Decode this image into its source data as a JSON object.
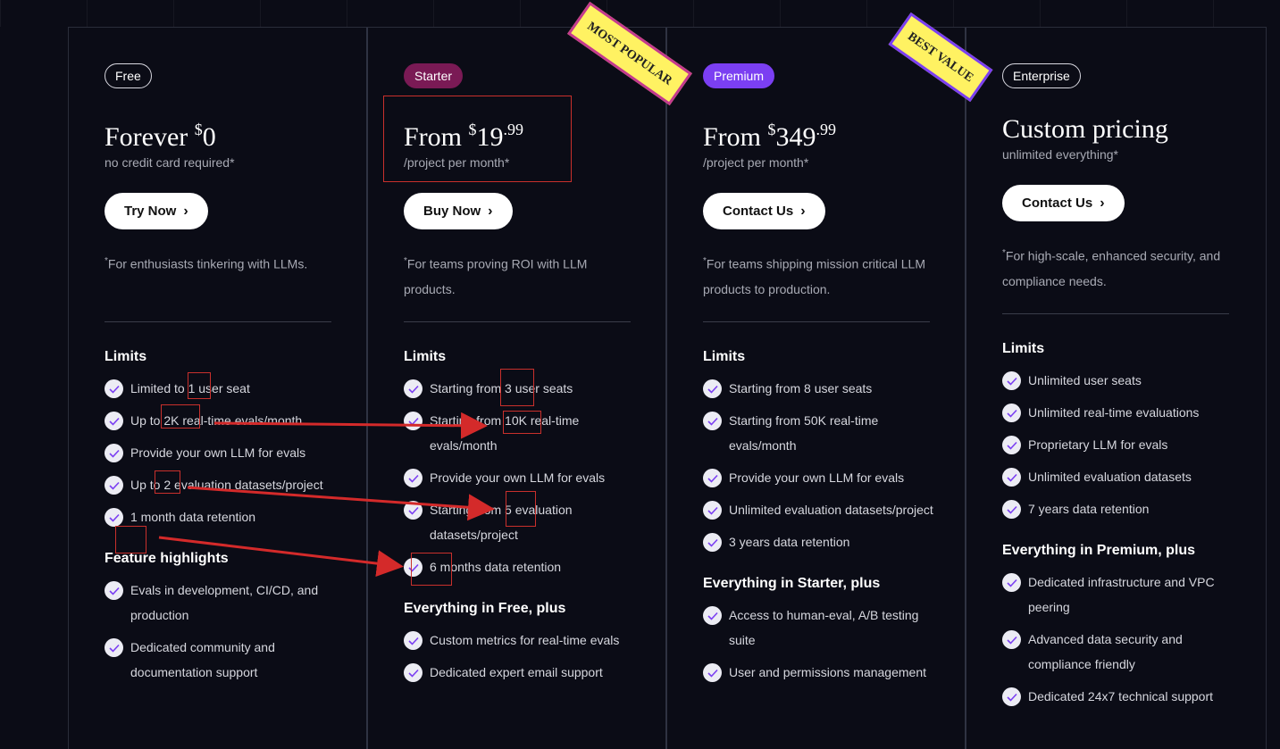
{
  "plans": [
    {
      "badge": "Free",
      "price_prefix": "Forever",
      "currency": "$",
      "price_main": "0",
      "price_cents": "",
      "price_sub": "no credit card required*",
      "cta": "Try Now",
      "desc_mark": "*",
      "desc": "For enthusiasts tinkering with LLMs.",
      "limits_title": "Limits",
      "limits": [
        "Limited to 1 user seat",
        "Up to 2K real-time evals/month",
        "Provide your own LLM for evals",
        "Up to 2 evaluation datasets/project",
        "1 month data retention"
      ],
      "features_title": "Feature highlights",
      "features": [
        "Evals in development, CI/CD, and production",
        "Dedicated community and documentation support"
      ]
    },
    {
      "badge": "Starter",
      "price_prefix": "From",
      "currency": "$",
      "price_main": "19",
      "price_cents": ".99",
      "price_sub": "/project per month*",
      "cta": "Buy Now",
      "desc_mark": "*",
      "desc": "For teams proving ROI with LLM products.",
      "limits_title": "Limits",
      "limits": [
        "Starting from 3 user seats",
        "Starting from 10K real-time evals/month",
        "Provide your own LLM for evals",
        "Starting from 5 evaluation datasets/project",
        "6 months data retention"
      ],
      "features_title": "Everything in Free, plus",
      "features": [
        "Custom metrics for real-time evals",
        "Dedicated expert email support"
      ]
    },
    {
      "badge": "Premium",
      "price_prefix": "From",
      "currency": "$",
      "price_main": "349",
      "price_cents": ".99",
      "price_sub": "/project per month*",
      "cta": "Contact Us",
      "desc_mark": "*",
      "desc": "For teams shipping mission critical LLM products to production.",
      "limits_title": "Limits",
      "limits": [
        "Starting from 8 user seats",
        "Starting from 50K real-time evals/month",
        "Provide your own LLM for evals",
        "Unlimited evaluation datasets/project",
        "3 years data retention"
      ],
      "features_title": "Everything in Starter, plus",
      "features": [
        "Access to human-eval, A/B testing suite",
        "User and permissions management"
      ]
    },
    {
      "badge": "Enterprise",
      "price_prefix": "Custom pricing",
      "currency": "",
      "price_main": "",
      "price_cents": "",
      "price_sub": "unlimited everything*",
      "cta": "Contact Us",
      "desc_mark": "*",
      "desc": "For high-scale, enhanced security, and compliance needs.",
      "limits_title": "Limits",
      "limits": [
        "Unlimited user seats",
        "Unlimited real-time evaluations",
        "Proprietary LLM for evals",
        "Unlimited evaluation datasets",
        "7 years data retention"
      ],
      "features_title": "Everything in Premium, plus",
      "features": [
        "Dedicated infrastructure and VPC peering",
        "Advanced data security and compliance friendly",
        "Dedicated 24x7 technical support"
      ]
    }
  ],
  "ribbons": {
    "popular": "MOST POPULAR",
    "best": "BEST VALUE"
  },
  "colors": {
    "background": "#0b0c16",
    "starter_badge": "#7a1a55",
    "premium_badge": "#7b3ff2",
    "ribbon_fill": "#fff262",
    "annotation": "#d42a2a"
  }
}
